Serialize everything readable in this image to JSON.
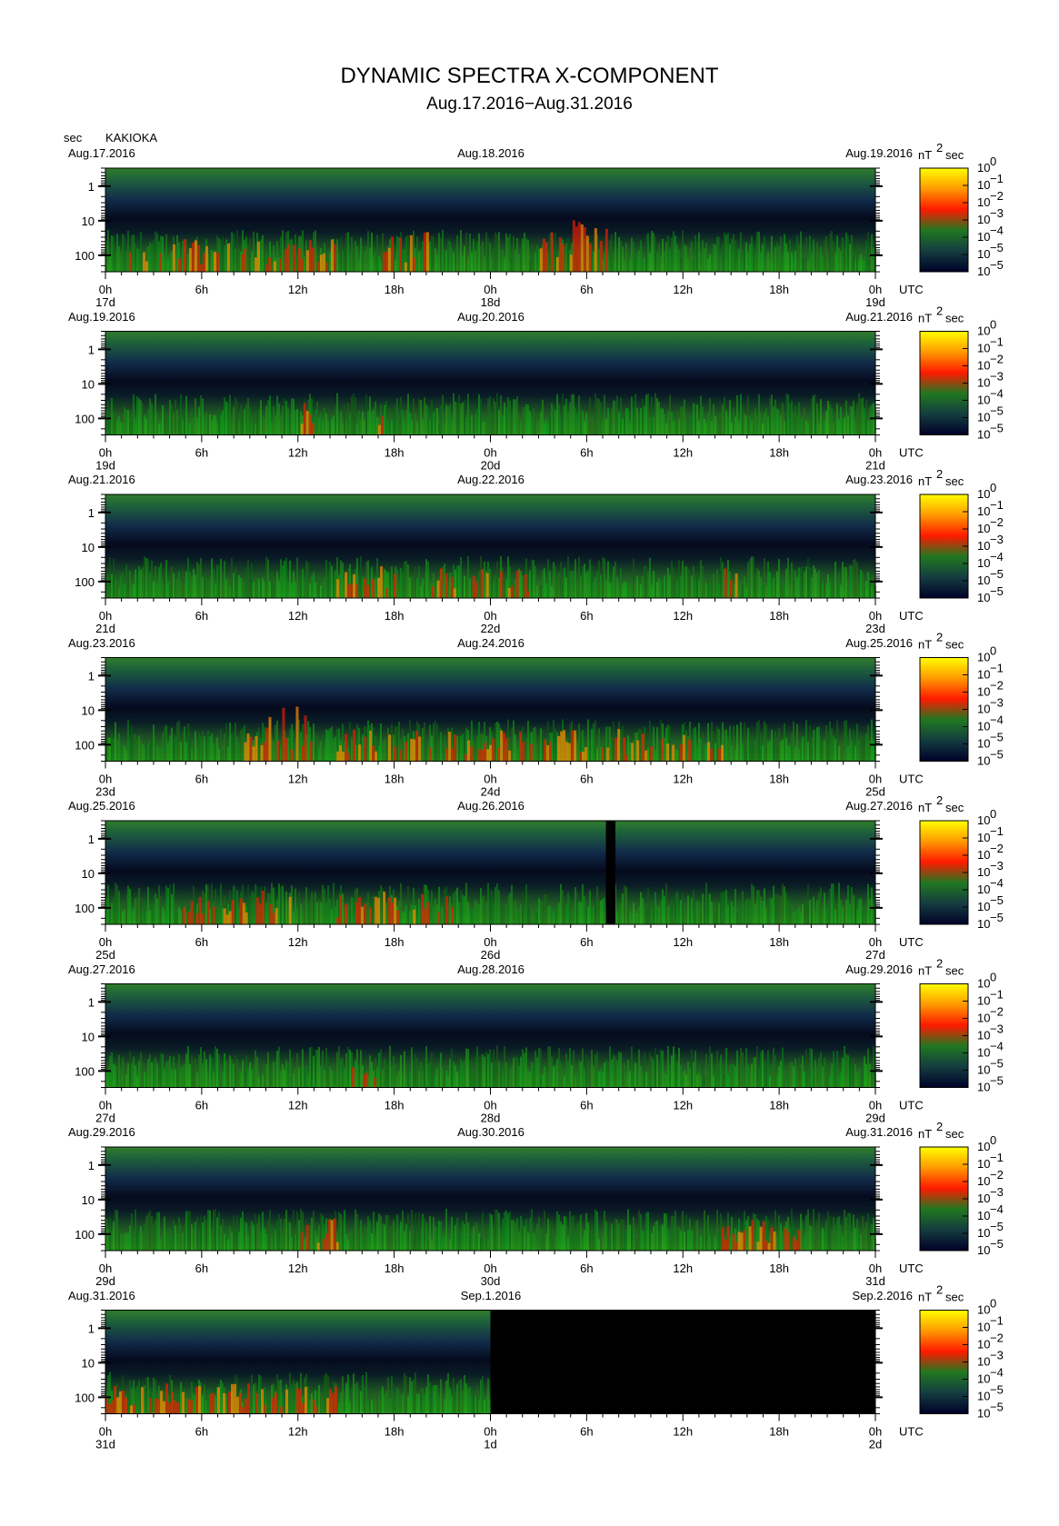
{
  "title": "DYNAMIC SPECTRA X-COMPONENT",
  "subtitle": "Aug.17.2016−Aug.31.2016",
  "station": "KAKIOKA",
  "y_unit": "sec",
  "colorbar_unit": "nT",
  "colorbar_unit_sup": "2",
  "colorbar_unit_suffix": "sec",
  "x_time_labels": [
    "0h",
    "6h",
    "12h",
    "18h",
    "0h",
    "6h",
    "12h",
    "18h",
    "0h"
  ],
  "utc_label": "UTC",
  "y_tick_labels": [
    "1",
    "10",
    "100"
  ],
  "colorbar_ticks": [
    {
      "base": "10",
      "exp": "0"
    },
    {
      "base": "10",
      "exp": "−1"
    },
    {
      "base": "10",
      "exp": "−2"
    },
    {
      "base": "10",
      "exp": "−3"
    },
    {
      "base": "10",
      "exp": "−4"
    },
    {
      "base": "10",
      "exp": "−5"
    },
    {
      "base": "10",
      "exp": "−5"
    }
  ],
  "colorbar_colors": [
    "#ffff00",
    "#ff9900",
    "#ff1a00",
    "#207820",
    "#143c40",
    "#000028"
  ],
  "chart_data": {
    "type": "heatmap",
    "title": "DYNAMIC SPECTRA X-COMPONENT",
    "subtitle": "Aug.17.2016−Aug.31.2016",
    "ylabel": "sec",
    "yscale": "log",
    "ylim": [
      0.3,
      300
    ],
    "colorbar_range": [
      "1e-5",
      "1e0"
    ],
    "panels": [
      {
        "left_date": "Aug.17.2016",
        "mid_date": "Aug.18.2016",
        "right_date": "Aug.19.2016",
        "day_labels": [
          "17d",
          "18d",
          "19d"
        ],
        "data_end_fraction": 1.0,
        "hot_spots": [
          [
            0.36,
            0.42,
            0.55
          ],
          [
            0.55,
            0.65,
            0.9
          ],
          [
            0.02,
            0.3,
            0.35
          ]
        ]
      },
      {
        "left_date": "Aug.19.2016",
        "mid_date": "Aug.20.2016",
        "right_date": "Aug.21.2016",
        "day_labels": [
          "19d",
          "20d",
          "21d"
        ],
        "data_end_fraction": 1.0,
        "hot_spots": [
          [
            0.25,
            0.27,
            0.4
          ],
          [
            0.34,
            0.36,
            0.4
          ]
        ]
      },
      {
        "left_date": "Aug.21.2016",
        "mid_date": "Aug.22.2016",
        "right_date": "Aug.23.2016",
        "day_labels": [
          "21d",
          "22d",
          "23d"
        ],
        "data_end_fraction": 1.0,
        "hot_spots": [
          [
            0.3,
            0.38,
            0.35
          ],
          [
            0.42,
            0.55,
            0.3
          ],
          [
            0.8,
            0.82,
            0.35
          ]
        ]
      },
      {
        "left_date": "Aug.23.2016",
        "mid_date": "Aug.24.2016",
        "right_date": "Aug.25.2016",
        "day_labels": [
          "23d",
          "24d",
          "25d"
        ],
        "data_end_fraction": 1.0,
        "hot_spots": [
          [
            0.18,
            0.27,
            1.0
          ],
          [
            0.3,
            0.8,
            0.35
          ]
        ]
      },
      {
        "left_date": "Aug.25.2016",
        "mid_date": "Aug.26.2016",
        "right_date": "Aug.27.2016",
        "day_labels": [
          "25d",
          "26d",
          "27d"
        ],
        "data_end_fraction": 1.0,
        "gap": [
          0.65,
          0.66
        ],
        "hot_spots": [
          [
            0.1,
            0.25,
            0.45
          ],
          [
            0.3,
            0.45,
            0.35
          ]
        ]
      },
      {
        "left_date": "Aug.27.2016",
        "mid_date": "Aug.28.2016",
        "right_date": "Aug.29.2016",
        "day_labels": [
          "27d",
          "28d",
          "29d"
        ],
        "data_end_fraction": 1.0,
        "hot_spots": [
          [
            0.32,
            0.35,
            0.35
          ]
        ]
      },
      {
        "left_date": "Aug.29.2016",
        "mid_date": "Aug.30.2016",
        "right_date": "Aug.31.2016",
        "day_labels": [
          "29d",
          "30d",
          "31d"
        ],
        "data_end_fraction": 1.0,
        "hot_spots": [
          [
            0.25,
            0.3,
            0.35
          ],
          [
            0.8,
            0.9,
            0.3
          ]
        ]
      },
      {
        "left_date": "Aug.31.2016",
        "mid_date": "Sep.1.2016",
        "right_date": "Sep.2.2016",
        "day_labels": [
          "31d",
          "1d",
          "2d"
        ],
        "data_end_fraction": 0.5,
        "hot_spots": [
          [
            0.0,
            0.3,
            0.3
          ]
        ]
      }
    ]
  }
}
